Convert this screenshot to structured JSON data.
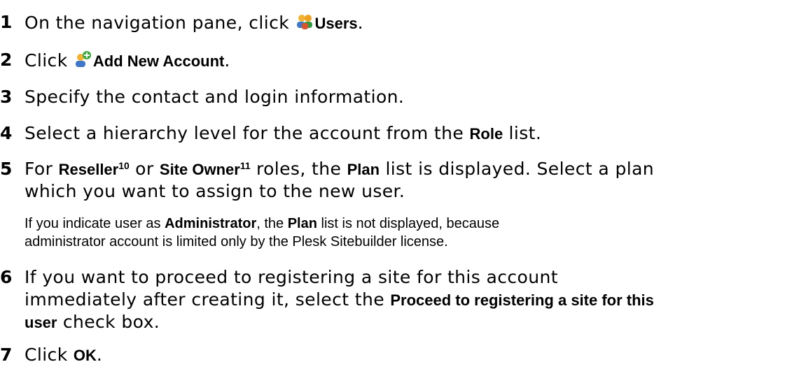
{
  "steps": [
    {
      "num": "1",
      "parts": [
        "On the navigation pane, click ",
        "Users",
        "."
      ],
      "icon": "users-icon"
    },
    {
      "num": "2",
      "parts": [
        "Click ",
        "Add New Account",
        "."
      ],
      "icon": "add-account-icon"
    },
    {
      "num": "3",
      "text": "Specify the contact and login information."
    },
    {
      "num": "4",
      "parts": [
        "Select a hierarchy level for the account from the ",
        "Role",
        " list."
      ]
    },
    {
      "num": "5",
      "line1": [
        "For ",
        "Reseller",
        "10",
        " or ",
        "Site Owner",
        "11",
        " roles, the ",
        "Plan",
        " list is displayed. Select a plan"
      ],
      "line2": "which you want to assign to the new user.",
      "note_line1": [
        "If you indicate user as ",
        "Administrator",
        ", the ",
        "Plan",
        " list is not displayed, because"
      ],
      "note_line2": "administrator account is limited only by the Plesk Sitebuilder license."
    },
    {
      "num": "6",
      "line1": "If you want to proceed to registering a site for this account",
      "line2": [
        "immediately after creating it, select the ",
        "Proceed to registering a site for this"
      ],
      "line3": [
        "user",
        " check box."
      ]
    },
    {
      "num": "7",
      "parts": [
        "Click ",
        "OK",
        "."
      ]
    }
  ]
}
